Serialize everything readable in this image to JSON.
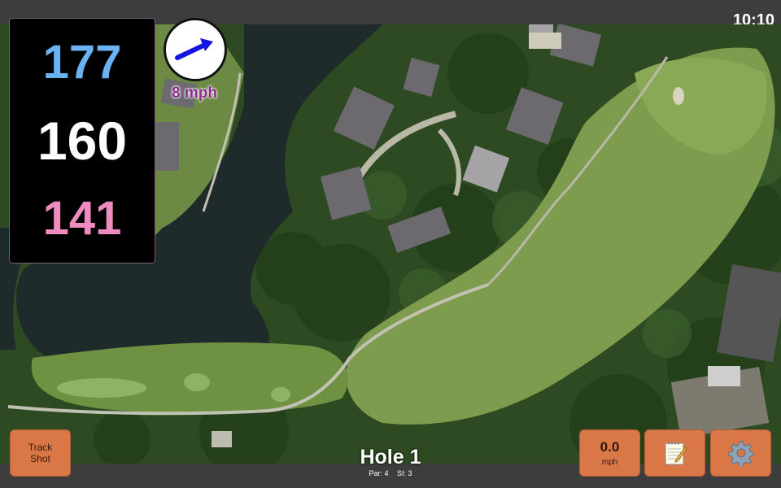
{
  "status_bar": {
    "time": "10:10"
  },
  "distances": {
    "back": "177",
    "middle": "160",
    "front": "141"
  },
  "wind": {
    "speed_label": "8 mph",
    "direction_icon": "wind-arrow-icon"
  },
  "buttons": {
    "track_shot_line1": "Track",
    "track_shot_line2": "Shot",
    "speed_value": "0.0",
    "speed_unit": "mph",
    "notes_icon": "notepad-icon",
    "settings_icon": "gear-icon"
  },
  "hole": {
    "title": "Hole 1",
    "par": "Par: 4",
    "si": "SI: 3"
  },
  "colors": {
    "back_distance": "#6ab2f2",
    "middle_distance": "#ffffff",
    "front_distance": "#f08bc0",
    "button": "#d97747",
    "wind_speed": "#8a2d8a"
  }
}
